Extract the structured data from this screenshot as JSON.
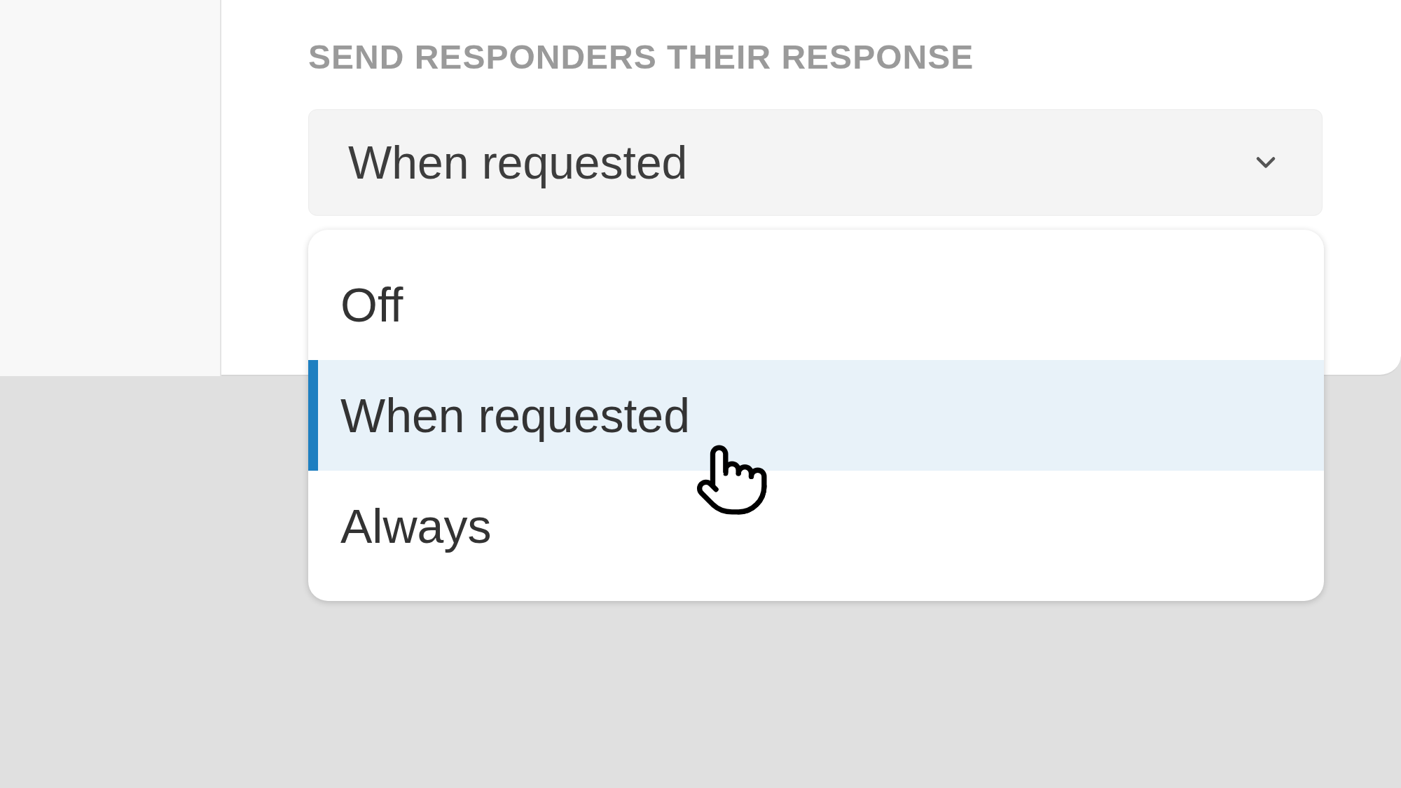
{
  "heading": "SEND RESPONDERS THEIR RESPONSE",
  "select": {
    "value": "When requested",
    "expanded": true
  },
  "options": [
    {
      "label": "Off",
      "selected": false
    },
    {
      "label": "When requested",
      "selected": true
    },
    {
      "label": "Always",
      "selected": false
    }
  ]
}
